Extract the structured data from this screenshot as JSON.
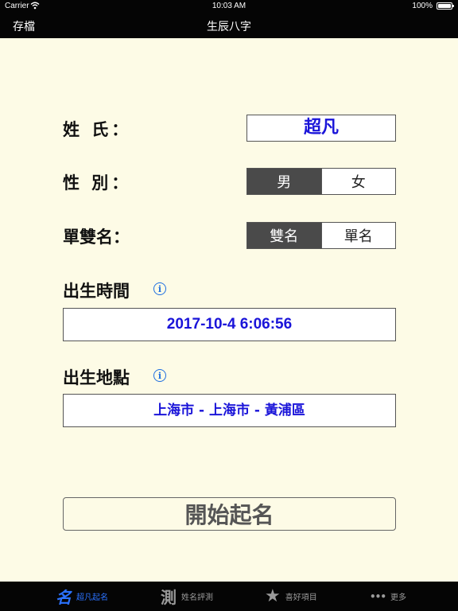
{
  "status_bar": {
    "carrier": "Carrier",
    "time": "10:03 AM",
    "battery": "100%"
  },
  "nav": {
    "left_button": "存檔",
    "title": "生辰八字"
  },
  "form": {
    "surname_label": "姓 氏：",
    "surname_value": "超凡",
    "gender_label": "性 別：",
    "gender_options": [
      "男",
      "女"
    ],
    "name_type_label": "單雙名：",
    "name_type_options": [
      "雙名",
      "單名"
    ],
    "birth_time_label": "出生時間",
    "birth_time_value": "2017-10-4 6:06:56",
    "birth_place_label": "出生地點",
    "birth_place_value": "上海市 - 上海市 - 黃浦區",
    "info_glyph": "i"
  },
  "start_button": "開始起名",
  "tabs": [
    {
      "icon": "名",
      "label": "超凡起名",
      "active": true
    },
    {
      "icon": "測",
      "label": "姓名評測",
      "active": false
    },
    {
      "icon": "★",
      "label": "喜好項目",
      "active": false
    },
    {
      "icon": "•••",
      "label": "更多",
      "active": false
    }
  ],
  "colors": {
    "accent_blue": "#1a14d9",
    "tab_active": "#2b72ff",
    "background": "#fdfbe6"
  }
}
